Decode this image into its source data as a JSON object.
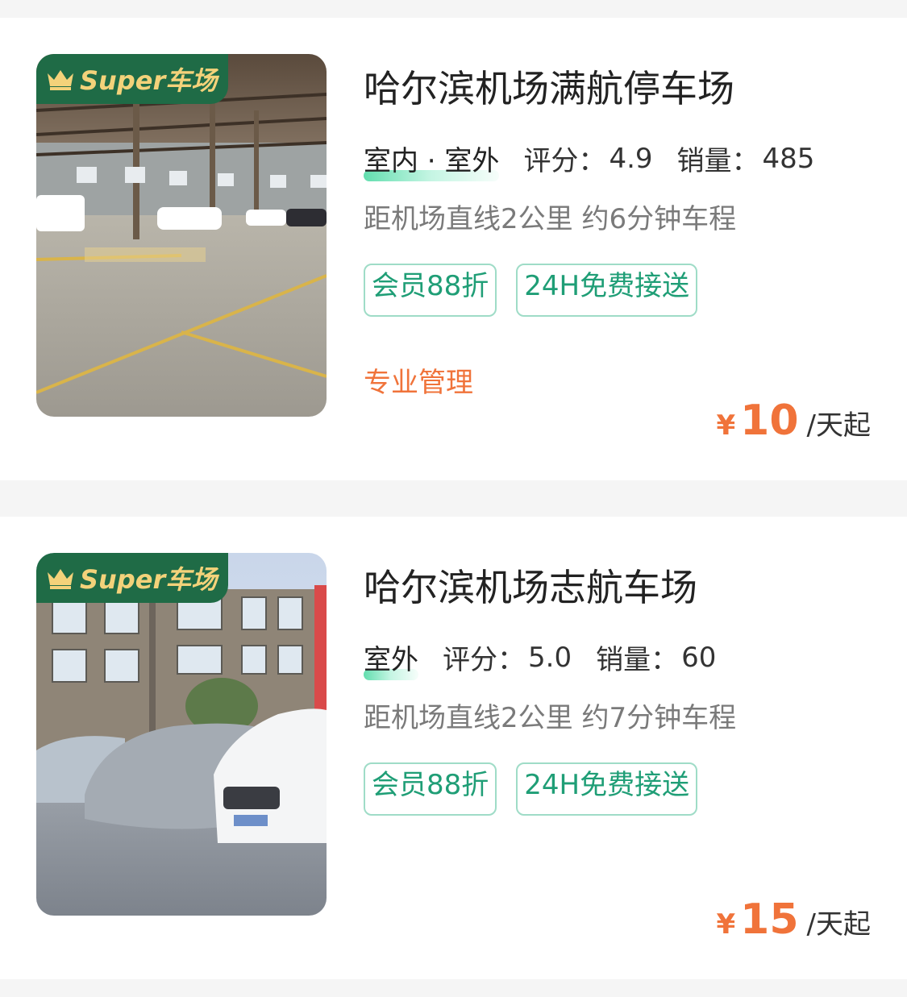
{
  "listings": [
    {
      "badge": "Super车场",
      "badge_icon": "crown-icon",
      "photo": "indoor-warehouse-parking-photo",
      "title": "哈尔滨机场满航停车场",
      "type": "室内 · 室外",
      "rating_label": "评分：",
      "rating": "4.9",
      "sales_label": "销量：",
      "sales": "485",
      "distance": "距机场直线2公里 约6分钟车程",
      "tags": [
        "会员88折",
        "24H免费接送"
      ],
      "feature": "专业管理",
      "currency": "¥",
      "price": "10",
      "unit": "/天起"
    },
    {
      "badge": "Super车场",
      "badge_icon": "crown-icon",
      "photo": "outdoor-covered-cars-photo",
      "title": "哈尔滨机场志航车场",
      "type": "室外",
      "rating_label": "评分：",
      "rating": "5.0",
      "sales_label": "销量：",
      "sales": "60",
      "distance": "距机场直线2公里 约7分钟车程",
      "tags": [
        "会员88折",
        "24H免费接送"
      ],
      "feature": "",
      "currency": "¥",
      "price": "15",
      "unit": "/天起"
    }
  ],
  "colors": {
    "badge_bg": "#1f6b46",
    "badge_text": "#f3d27a",
    "tag_text": "#1f9e76",
    "tag_border": "#9fdcc7",
    "accent_orange": "#f0733a"
  }
}
